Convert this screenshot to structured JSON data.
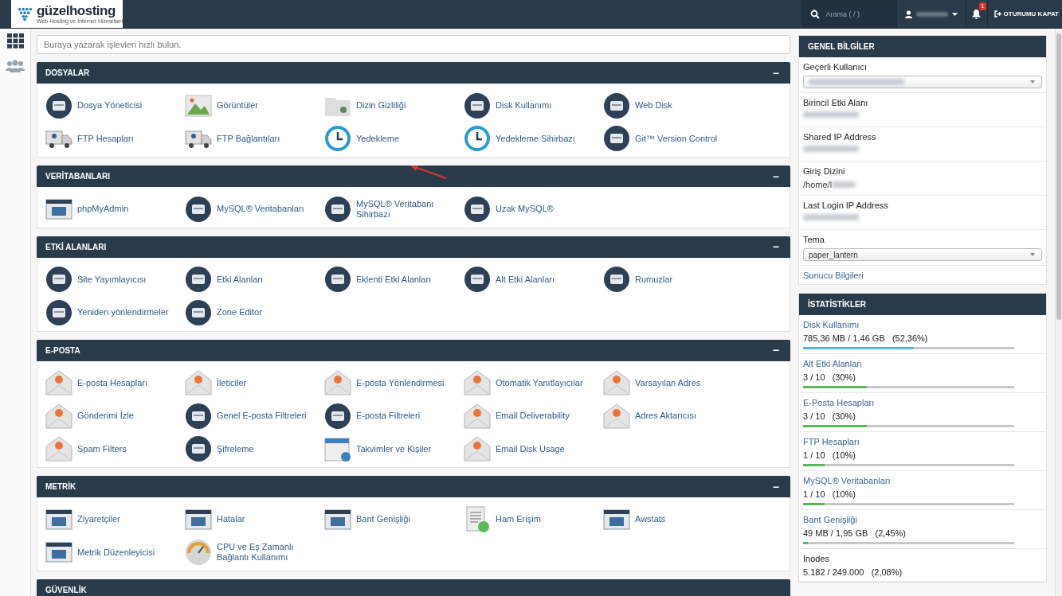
{
  "header": {
    "logo": "güzelhosting",
    "logo_tagline": "Web Hosting ve İnternet Hizmetleri",
    "search_placeholder": "Arama ( / )",
    "notification_count": "1",
    "logout": "OTURUMU KAPAT"
  },
  "quick_search": {
    "placeholder": "Buraya yazarak işlevleri hızlı bulun."
  },
  "sections": [
    {
      "title": "DOSYALAR",
      "toggle": "−",
      "items": [
        {
          "label": "Dosya Yöneticisi",
          "kind": "disk"
        },
        {
          "label": "Görüntüler",
          "kind": "image"
        },
        {
          "label": "Dizin Gizliliği",
          "kind": "folder"
        },
        {
          "label": "Disk Kullanımı",
          "kind": "disk"
        },
        {
          "label": "Web Disk",
          "kind": "disk"
        },
        {
          "label": "FTP Hesapları",
          "kind": "truck"
        },
        {
          "label": "FTP Bağlantıları",
          "kind": "truck"
        },
        {
          "label": "Yedekleme",
          "kind": "clock"
        },
        {
          "label": "Yedekleme Sihirbazı",
          "kind": "clock"
        },
        {
          "label": "Git™ Version Control",
          "kind": "disk"
        }
      ]
    },
    {
      "title": "VERİTABANLARI",
      "toggle": "−",
      "items": [
        {
          "label": "phpMyAdmin",
          "kind": "window"
        },
        {
          "label": "MySQL® Veritabanları",
          "kind": "disk"
        },
        {
          "label": "MySQL® Veritabanı Sihirbazı",
          "kind": "disk"
        },
        {
          "label": "Uzak MySQL®",
          "kind": "disk"
        }
      ]
    },
    {
      "title": "ETKİ ALANLARI",
      "toggle": "−",
      "items": [
        {
          "label": "Site Yayımlayıcısı",
          "kind": "disk"
        },
        {
          "label": "Etki Alanları",
          "kind": "disk"
        },
        {
          "label": "Eklenti Etki Alanları",
          "kind": "disk"
        },
        {
          "label": "Alt Etki Alanları",
          "kind": "disk"
        },
        {
          "label": "Rumuzlar",
          "kind": "disk"
        },
        {
          "label": "Yeniden yönlendirmeler",
          "kind": "disk"
        },
        {
          "label": "Zone Editor",
          "kind": "disk"
        }
      ]
    },
    {
      "title": "E-POSTA",
      "toggle": "−",
      "items": [
        {
          "label": "E-posta Hesapları",
          "kind": "envelope"
        },
        {
          "label": "İleticiler",
          "kind": "envelope"
        },
        {
          "label": "E-posta Yönlendirmesi",
          "kind": "envelope"
        },
        {
          "label": "Otomatik Yanıtlayıcılar",
          "kind": "envelope"
        },
        {
          "label": "Varsayılan Adres",
          "kind": "envelope"
        },
        {
          "label": "Gönderimi İzle",
          "kind": "envelope"
        },
        {
          "label": "Genel E-posta Filtreleri",
          "kind": "disk"
        },
        {
          "label": "E-posta Filtreleri",
          "kind": "disk"
        },
        {
          "label": "Email Deliverability",
          "kind": "envelope"
        },
        {
          "label": "Adres Aktarıcısı",
          "kind": "envelope"
        },
        {
          "label": "Spam Filters",
          "kind": "envelope"
        },
        {
          "label": "Şifreleme",
          "kind": "disk"
        },
        {
          "label": "Takvimler ve Kişiler",
          "kind": "calendar"
        },
        {
          "label": "Email Disk Usage",
          "kind": "envelope"
        }
      ]
    },
    {
      "title": "METRİK",
      "toggle": "−",
      "items": [
        {
          "label": "Ziyaretçiler",
          "kind": "window"
        },
        {
          "label": "Hatalar",
          "kind": "window"
        },
        {
          "label": "Bant Genişliği",
          "kind": "window"
        },
        {
          "label": "Ham Erişim",
          "kind": "document"
        },
        {
          "label": "Awstats",
          "kind": "window"
        },
        {
          "label": "Metrik Düzenleyicisi",
          "kind": "window"
        },
        {
          "label": "CPU ve Eş Zamanlı Bağlantı Kullanımı",
          "kind": "gauge"
        }
      ]
    },
    {
      "title": "GÜVENLİK"
    }
  ],
  "general_info": {
    "title": "GENEL BİLGİLER",
    "rows": [
      {
        "label": "Geçerli Kullanıcı",
        "kind": "select"
      },
      {
        "label": "Birincil Etki Alanı",
        "kind": "hidden"
      },
      {
        "label": "Shared IP Address",
        "kind": "hidden"
      },
      {
        "label": "Giriş Dizini",
        "kind": "text",
        "value": "/home/l"
      },
      {
        "label": "Last Login IP Address",
        "kind": "hidden"
      },
      {
        "label": "Tema",
        "kind": "select",
        "value": "paper_lantern"
      }
    ],
    "link": "Sunucu Bilgileri"
  },
  "statistics": {
    "title": "İSTATİSTİKLER",
    "rows": [
      {
        "label": "Disk Kullanımı",
        "reading": "785,36 MB / 1,46 GB   (52,36%)",
        "level": 0.5236,
        "color": "#5bb6d6"
      },
      {
        "label": "Alt Etki Alanları",
        "reading": "3 / 10   (30%)",
        "level": 0.3,
        "color": "#5cb85c"
      },
      {
        "label": "E-Posta Hesapları",
        "reading": "3 / 10   (30%)",
        "level": 0.3,
        "color": "#5cb85c"
      },
      {
        "label": "FTP Hesapları",
        "reading": "1 / 10   (10%)",
        "level": 0.1,
        "color": "#5cb85c"
      },
      {
        "label": "MySQL® Veritabanları",
        "reading": "1 / 10   (10%)",
        "level": 0.1,
        "color": "#5cb85c"
      },
      {
        "label": "Bant Genişliği",
        "reading": "49 MB / 1,95 GB   (2,45%)",
        "level": 0.0245,
        "color": "#5cb85c"
      },
      {
        "label": "Inodes",
        "reading": "5.182 / 249.000   (2,08%)"
      }
    ]
  }
}
